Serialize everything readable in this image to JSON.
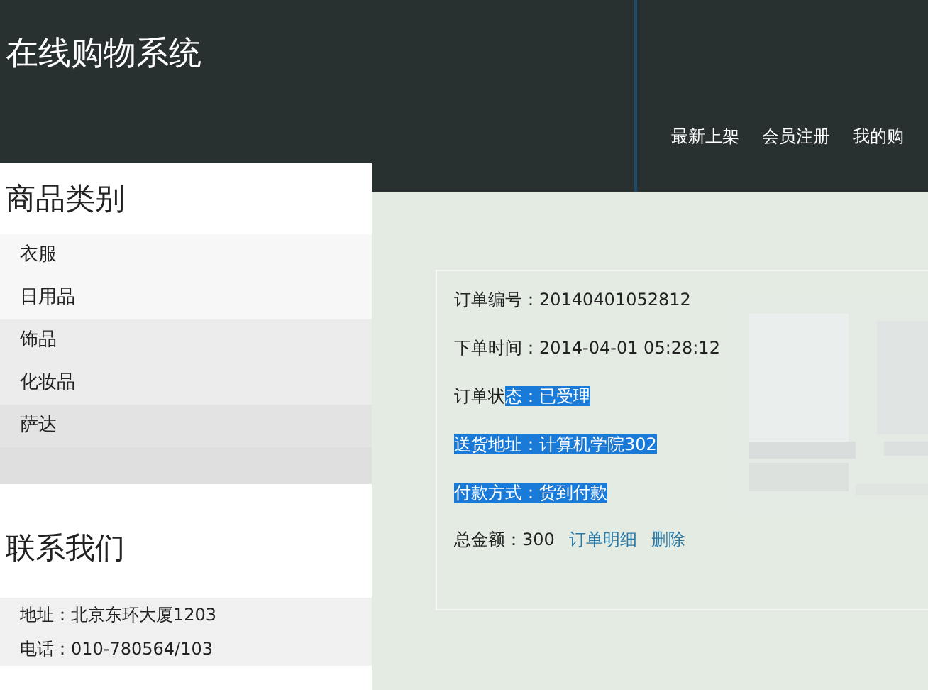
{
  "header": {
    "title": "在线购物系统",
    "nav": [
      "最新上架",
      "会员注册",
      "我的购"
    ]
  },
  "sidebar": {
    "categories_title": "商品类别",
    "categories": [
      {
        "label": "衣服",
        "color": "#f7f7f7"
      },
      {
        "label": "日用品",
        "color": "#f7f7f7"
      },
      {
        "label": "饰品",
        "color": "#ececec"
      },
      {
        "label": "化妆品",
        "color": "#ececec"
      },
      {
        "label": "萨达",
        "color": "#e3e3e3"
      }
    ],
    "contact_title": "联系我们",
    "contact": [
      "地址：北京东环大厦1203",
      "电话：010-780564/103"
    ]
  },
  "order": {
    "fields": [
      {
        "parts": [
          {
            "text": "订单编号：20140401052812",
            "highlighted": false
          }
        ]
      },
      {
        "parts": [
          {
            "text": "下单时间：2014-04-01 05:28:12",
            "highlighted": false
          }
        ]
      },
      {
        "parts": [
          {
            "text": "订单状",
            "highlighted": false
          },
          {
            "text": "态：已受理",
            "highlighted": true
          }
        ]
      },
      {
        "parts": [
          {
            "text": "送货地址：计算机学院302",
            "highlighted": true
          }
        ]
      },
      {
        "parts": [
          {
            "text": "付款方式：货到付款",
            "highlighted": true
          }
        ]
      }
    ],
    "total": "总金额：300",
    "links": [
      "订单明细",
      "删除"
    ],
    "image": {
      "kind": "picture"
    }
  }
}
